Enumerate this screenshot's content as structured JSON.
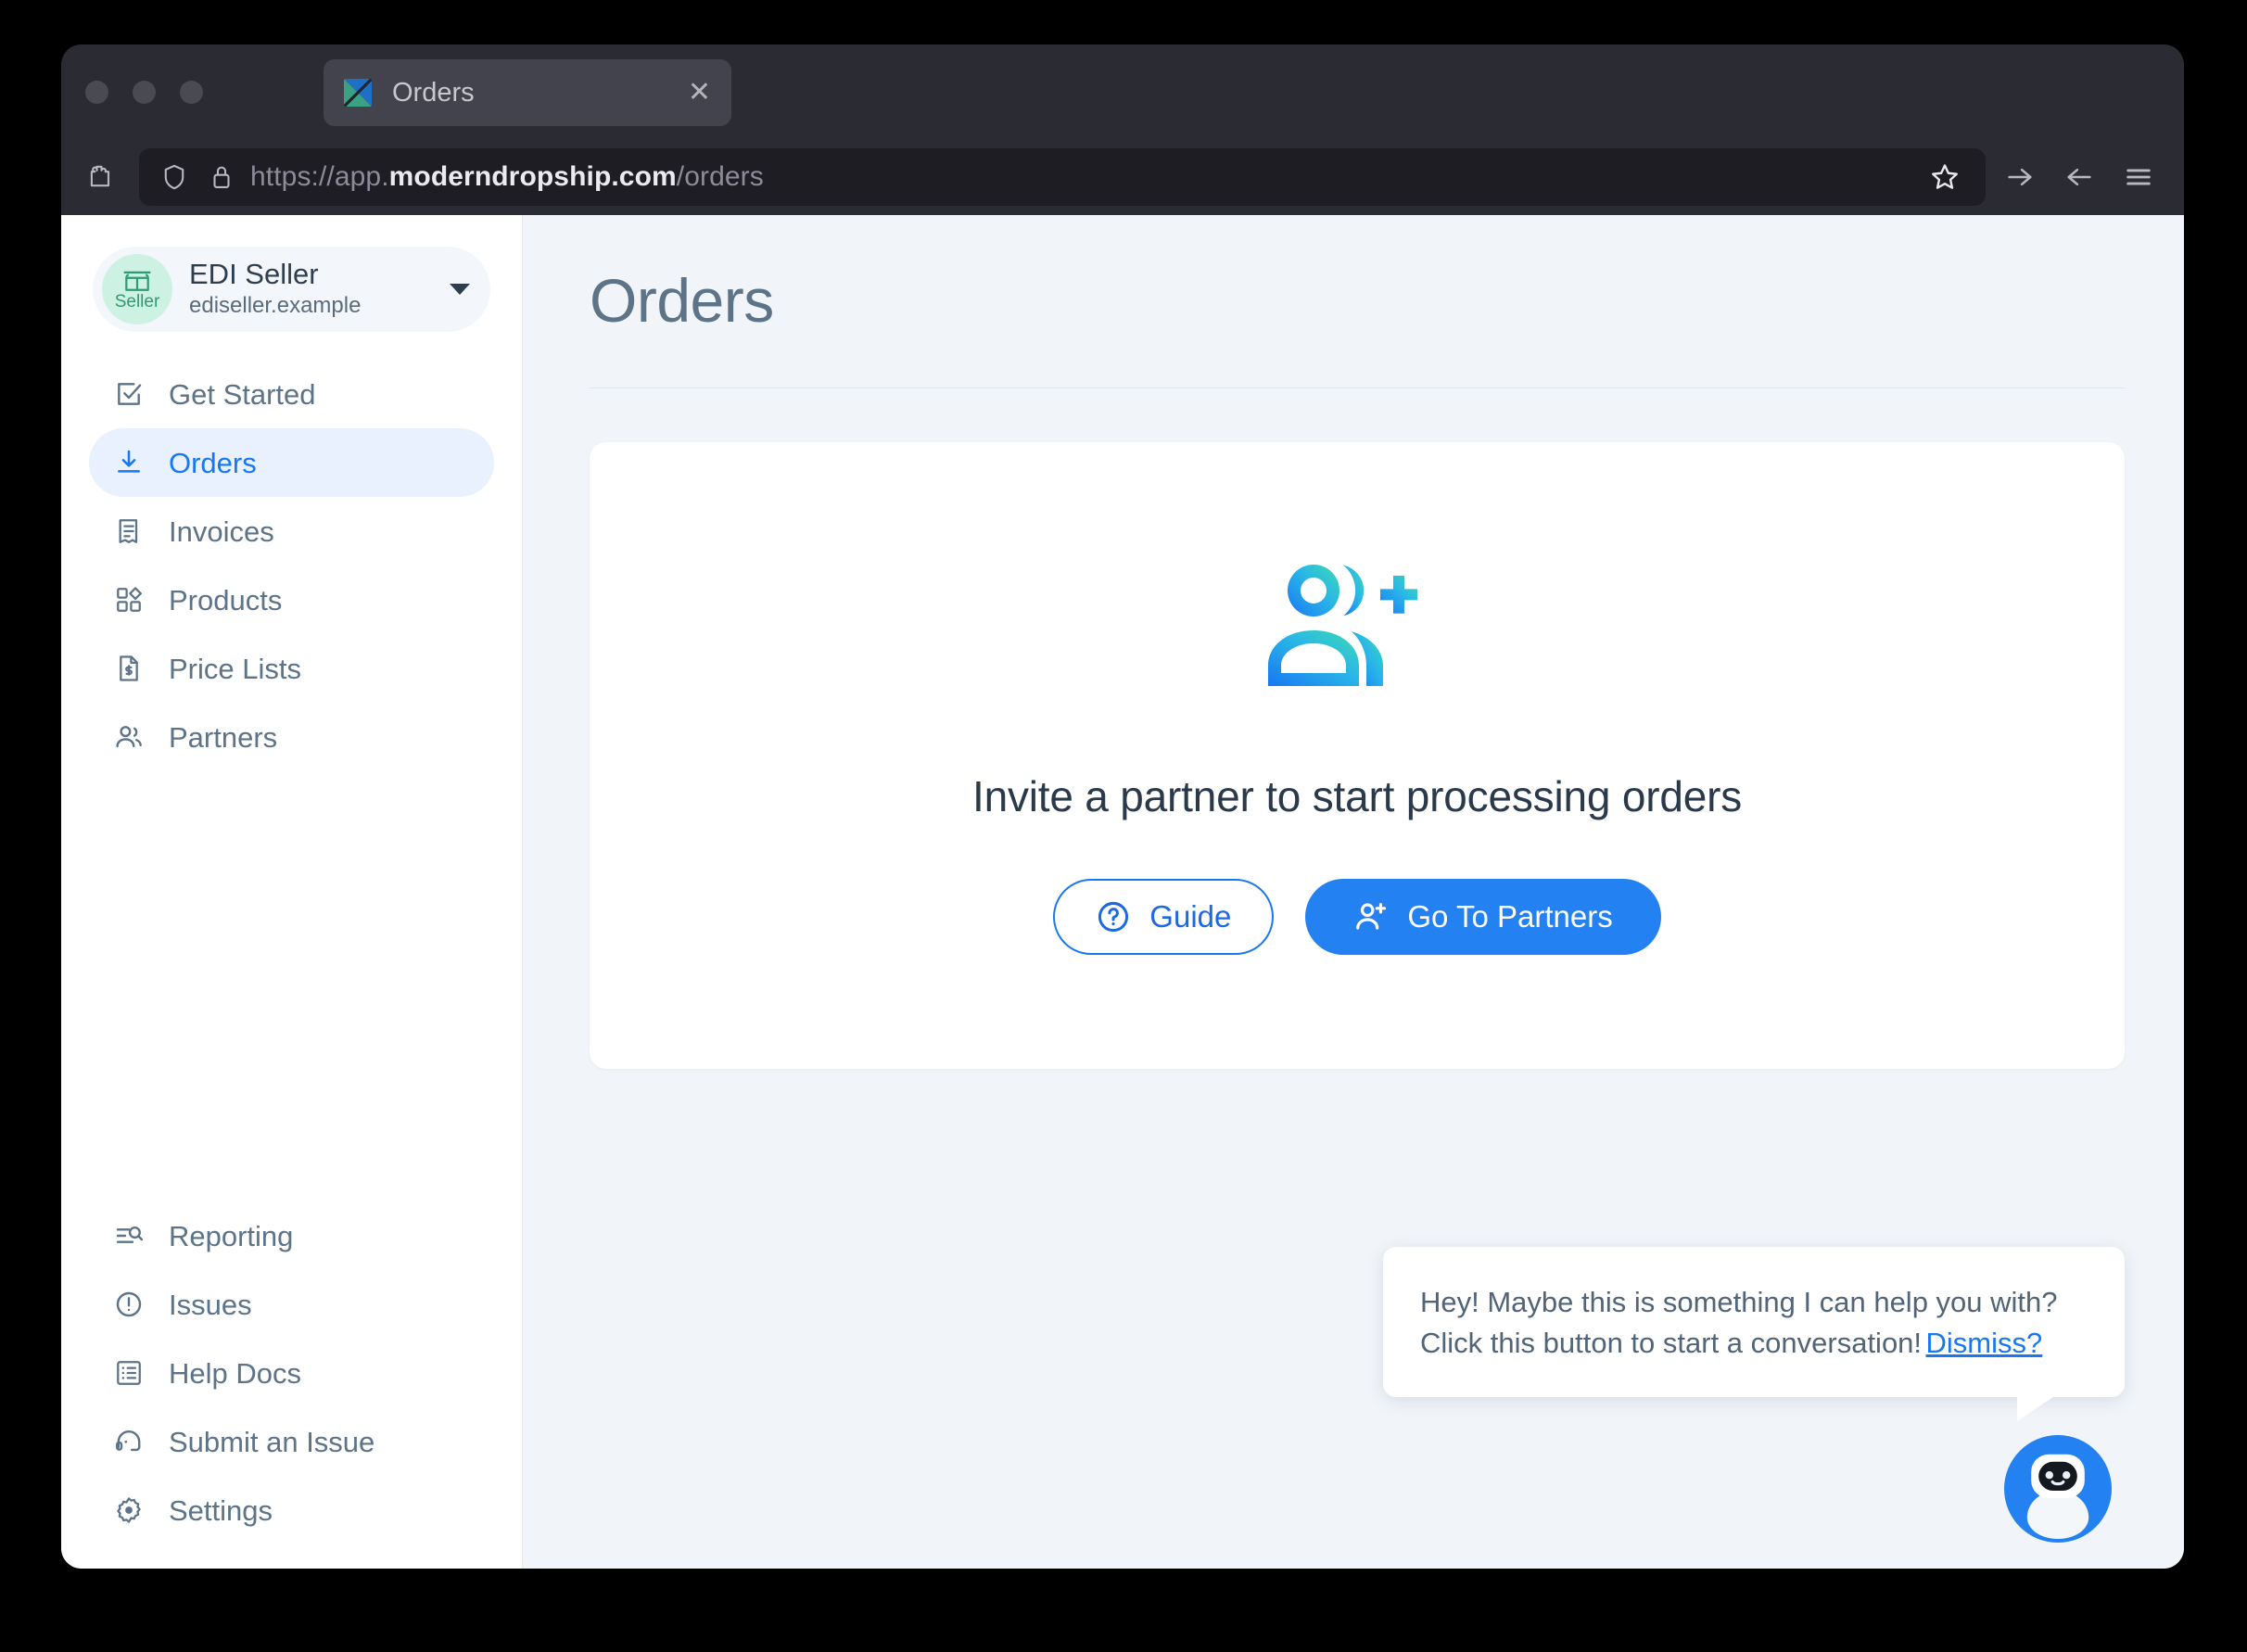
{
  "browser": {
    "tab": {
      "title": "Orders",
      "favicon": "app-logo-icon",
      "close": "✕"
    },
    "url_prefix": "https://app.",
    "url_domain": "moderndropship.com",
    "url_path": "/orders",
    "icons": {
      "extensions": "puzzle-icon",
      "shield": "shield-icon",
      "lock": "lock-icon",
      "bookmark": "star-icon",
      "forward": "forward-arrow-icon",
      "back": "back-arrow-icon",
      "menu": "hamburger-menu-icon"
    }
  },
  "sidebar": {
    "account": {
      "badge_label": "Seller",
      "name": "EDI Seller",
      "subtitle": "ediseller.example"
    },
    "items": [
      {
        "label": "Get Started",
        "icon": "checkbox-check-icon",
        "active": false
      },
      {
        "label": "Orders",
        "icon": "download-icon",
        "active": true
      },
      {
        "label": "Invoices",
        "icon": "receipt-icon",
        "active": false
      },
      {
        "label": "Products",
        "icon": "grid-diamond-icon",
        "active": false
      },
      {
        "label": "Price Lists",
        "icon": "document-dollar-icon",
        "active": false
      },
      {
        "label": "Partners",
        "icon": "people-icon",
        "active": false
      }
    ],
    "bottom_items": [
      {
        "label": "Reporting",
        "icon": "list-search-icon"
      },
      {
        "label": "Issues",
        "icon": "alert-circle-icon"
      },
      {
        "label": "Help Docs",
        "icon": "list-panel-icon"
      },
      {
        "label": "Submit an Issue",
        "icon": "headset-icon"
      },
      {
        "label": "Settings",
        "icon": "gear-icon"
      }
    ]
  },
  "main": {
    "title": "Orders",
    "empty_state": {
      "illustration": "add-people-icon",
      "heading": "Invite a partner to start processing orders",
      "guide_button": "Guide",
      "guide_icon": "question-circle-icon",
      "primary_button": "Go To Partners",
      "primary_icon": "person-plus-icon"
    }
  },
  "chat": {
    "message": "Hey! Maybe this is something I can help you with? Click this button to start a conversation!",
    "dismiss_label": "Dismiss?",
    "fab_icon": "chat-bot-icon"
  },
  "colors": {
    "accent_blue": "#2481f2",
    "link_blue": "#1877f2",
    "nav_active_bg": "#e8f1fd",
    "seller_green": "#2e9b74",
    "seller_badge_bg": "#cdf1e2",
    "page_bg": "#f1f5f9",
    "text_slate": "#5c7388"
  }
}
